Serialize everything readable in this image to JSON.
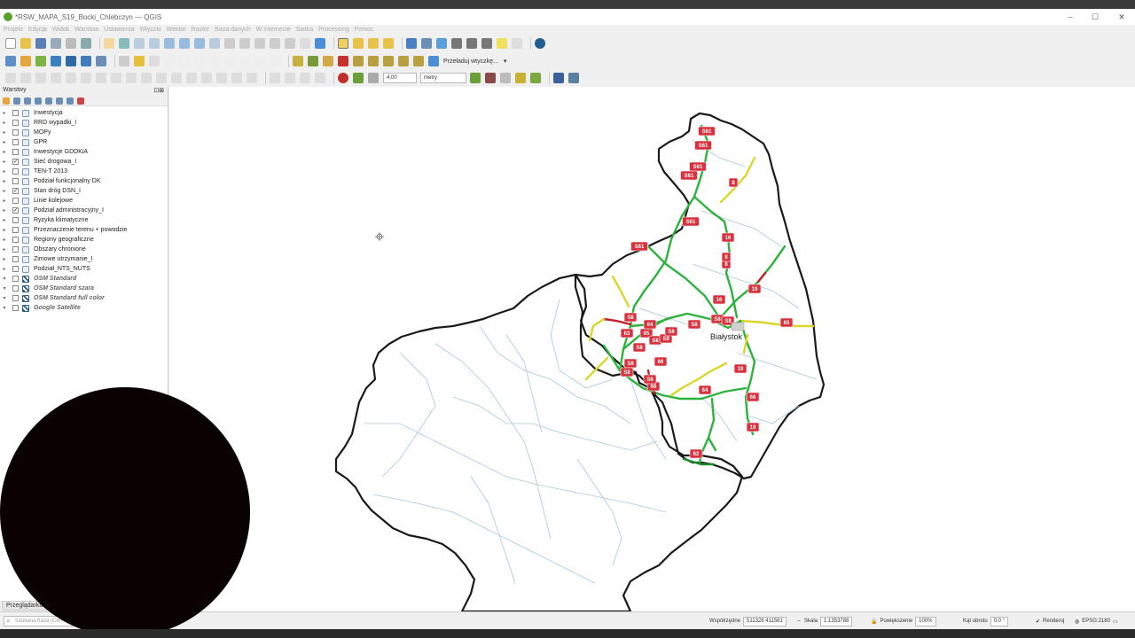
{
  "window": {
    "title": "*RSW_MAPA_S19_Bocki_Chlebczyn — QGIS",
    "minimize": "–",
    "maximize": "☐",
    "close": "✕"
  },
  "menu": [
    "Projekt",
    "Edycja",
    "Widok",
    "Warstwa",
    "Ustawienia",
    "Wtyczki",
    "Wektor",
    "Raster",
    "Baza danych",
    "W internecie",
    "Siatka",
    "Processing",
    "Pomoc"
  ],
  "toolbar": {
    "reload_plugin": "Przeładuj wtyczkę...",
    "snap_tolerance": "4,00",
    "snap_unit": "metry"
  },
  "layers_panel": {
    "title": "Warstwy",
    "items": [
      {
        "name": "Inwestycja",
        "checked": false,
        "osm": false
      },
      {
        "name": "RRD wypadki_I",
        "checked": false,
        "osm": false
      },
      {
        "name": "MOPy",
        "checked": false,
        "osm": false
      },
      {
        "name": "GPR",
        "checked": false,
        "osm": false
      },
      {
        "name": "Inwestycje GDDKiA",
        "checked": false,
        "osm": false
      },
      {
        "name": "Sieć drogowa_I",
        "checked": true,
        "osm": false
      },
      {
        "name": "TEN-T 2013",
        "checked": false,
        "osm": false
      },
      {
        "name": "Podział funkcjonalny DK",
        "checked": false,
        "osm": false
      },
      {
        "name": "Stan dróg DSN_I",
        "checked": true,
        "osm": false
      },
      {
        "name": "Linie kolejowe",
        "checked": false,
        "osm": false
      },
      {
        "name": "Podział administracyjny_I",
        "checked": true,
        "osm": false
      },
      {
        "name": "Ryzyka klimatyczne",
        "checked": false,
        "osm": false
      },
      {
        "name": "Przeznaczenie terenu + powodzie",
        "checked": false,
        "osm": false
      },
      {
        "name": "Regiony geograficzne",
        "checked": false,
        "osm": false
      },
      {
        "name": "Obszary chronione",
        "checked": false,
        "osm": false
      },
      {
        "name": "Zimowe utrzymanie_I",
        "checked": false,
        "osm": false
      },
      {
        "name": "Podział_NTS_NUTS",
        "checked": false,
        "osm": false
      },
      {
        "name": "OSM Standard",
        "checked": false,
        "osm": true
      },
      {
        "name": "OSM Standard szara",
        "checked": false,
        "osm": true
      },
      {
        "name": "OSM Standard full color",
        "checked": false,
        "osm": true
      },
      {
        "name": "Google Satellite",
        "checked": false,
        "osm": true
      }
    ]
  },
  "browser_tab": "Przeglądarka",
  "map": {
    "city_label": "Białystok",
    "road_labels": [
      "S61",
      "S61",
      "S61",
      "S61",
      "8",
      "S61",
      "16",
      "8",
      "S61",
      "S8",
      "S8",
      "S8",
      "19",
      "65",
      "16",
      "65",
      "S8",
      "S8",
      "S8",
      "63",
      "S8",
      "S8",
      "S8",
      "66",
      "19",
      "64",
      "66",
      "62",
      "19",
      "66",
      "S8",
      "64",
      "S8",
      "8"
    ]
  },
  "status": {
    "search_placeholder": "Szukana fraza (Ctrl+K)",
    "coords_label": "Współrzędne",
    "coords_value": "511328 411581",
    "scale_label": "Skala",
    "scale_value": "1:1353788",
    "magnifier_label": "Powiększenie",
    "magnifier_value": "100%",
    "rotation_label": "Kąt obrotu",
    "rotation_value": "0,0 °",
    "render_label": "Renderuj",
    "crs": "EPSG:2180"
  },
  "colors": {
    "road_good": "#2db33d",
    "road_fair": "#d9d72a",
    "road_poor": "#c0202a",
    "road_label_bg": "#d8323f",
    "boundary": "#1a1a1a",
    "district": "#a9c7d6"
  }
}
